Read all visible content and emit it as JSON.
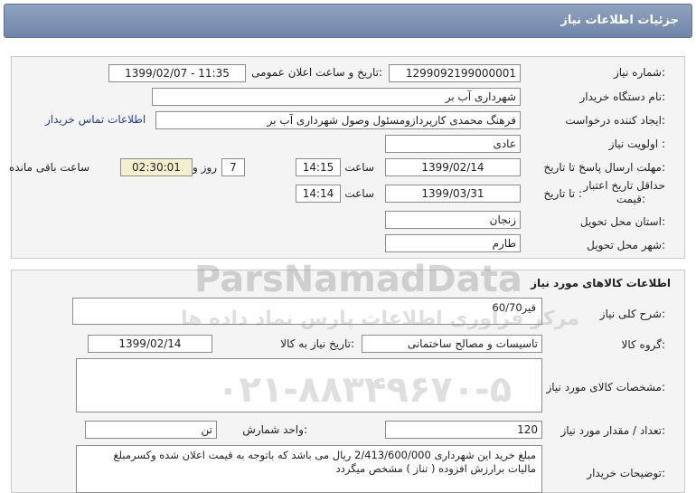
{
  "header": {
    "title": "جزئیات اطلاعات نیاز"
  },
  "info": {
    "need_number_label": "شماره نیاز:",
    "need_number": "1299092199000001",
    "announce_label": "تاریخ و ساعت اعلان عمومی:",
    "announce_value": "1399/02/07 - 11:35",
    "buyer_org_label": "نام دستگاه خریدار:",
    "buyer_org": "شهرداری آب بر",
    "creator_label": "ایجاد کننده درخواست:",
    "creator": "فرهنگ محمدی کارپردازومسئول وصول شهرداری آب بر",
    "contact_link": "اطلاعات تماس خریدار",
    "priority_label": "اولویت نیاز :",
    "priority": "عادی",
    "deadline_label": "مهلت ارسال پاسخ:",
    "deadline_until": "تا تاریخ :",
    "deadline_date": "1399/02/14",
    "time_label": "ساعت",
    "deadline_time": "14:15",
    "days_count": "7",
    "days_label": "روز و",
    "remaining_time": "02:30:01",
    "remaining_label": "ساعت باقی مانده",
    "validity_label_1": "حداقل تاریخ اعتبار",
    "validity_label_2": "قیمت:",
    "validity_until": "تا تاریخ :",
    "validity_date": "1399/03/31",
    "validity_time": "14:14",
    "province_label": "استان محل تحویل:",
    "province": "زنجان",
    "city_label": "شهر محل تحویل:",
    "city": "طارم"
  },
  "goods": {
    "section_title": "اطلاعات کالاهای مورد نیاز",
    "summary_label": "شرح کلی نیاز:",
    "summary": "قیر60/70",
    "group_label": "گروه کالا:",
    "group": "تاسیسات و مصالح ساختمانی",
    "need_date_label": "تاریخ نیاز به کالا:",
    "need_date": "1399/02/14",
    "specs_label": "مشخصات کالای مورد نیاز:",
    "specs": "",
    "qty_label": "تعداد / مقدار مورد نیاز:",
    "qty": "120",
    "unit_label": "واحد شمارش:",
    "unit": "تن",
    "buyer_notes_label": "توضیحات خریدار:",
    "buyer_notes": "مبلغ خرید این شهرداری 2/413/600/000 ریال می باشد که باتوجه به قیمت اعلان شده وکسرمبلغ مالیات برارزش افزوده  ( تناز ) مشخص میگردد"
  },
  "watermark": {
    "brand": "ParsNamadData",
    "tagline": "مرکز فرآوری اطلاعات پارس نماد داده ها",
    "phone": "۰۲۱-۸۸۳۴۹۶۷۰-۵"
  }
}
